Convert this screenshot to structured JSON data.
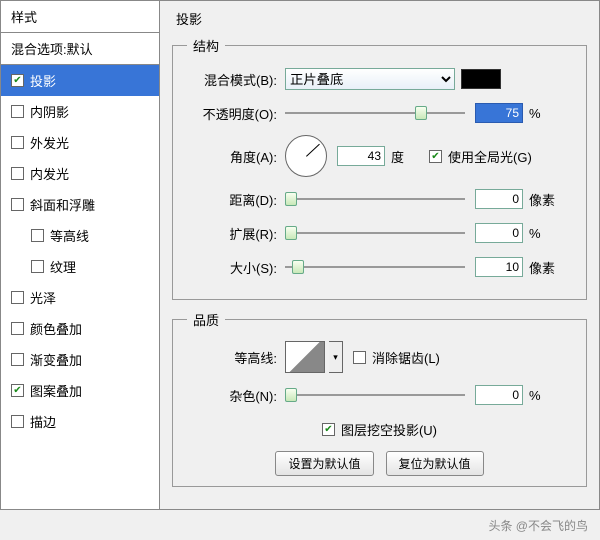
{
  "sidebar": {
    "header": "样式",
    "subheader": "混合选项:默认",
    "items": [
      {
        "label": "投影",
        "checked": true,
        "selected": true
      },
      {
        "label": "内阴影",
        "checked": false
      },
      {
        "label": "外发光",
        "checked": false
      },
      {
        "label": "内发光",
        "checked": false
      },
      {
        "label": "斜面和浮雕",
        "checked": false
      },
      {
        "label": "等高线",
        "checked": false,
        "indent": true
      },
      {
        "label": "纹理",
        "checked": false,
        "indent": true
      },
      {
        "label": "光泽",
        "checked": false
      },
      {
        "label": "颜色叠加",
        "checked": false
      },
      {
        "label": "渐变叠加",
        "checked": false
      },
      {
        "label": "图案叠加",
        "checked": true
      },
      {
        "label": "描边",
        "checked": false
      }
    ]
  },
  "panel": {
    "title": "投影",
    "structure": {
      "legend": "结构",
      "blend_mode_label": "混合模式(B):",
      "blend_mode_value": "正片叠底",
      "color": "#000000",
      "opacity_label": "不透明度(O):",
      "opacity_value": "75",
      "opacity_unit": "%",
      "angle_label": "角度(A):",
      "angle_value": "43",
      "angle_unit": "度",
      "global_light_label": "使用全局光(G)",
      "global_light_checked": true,
      "distance_label": "距离(D):",
      "distance_value": "0",
      "distance_unit": "像素",
      "spread_label": "扩展(R):",
      "spread_value": "0",
      "spread_unit": "%",
      "size_label": "大小(S):",
      "size_value": "10",
      "size_unit": "像素"
    },
    "quality": {
      "legend": "品质",
      "contour_label": "等高线:",
      "antialias_label": "消除锯齿(L)",
      "antialias_checked": false,
      "noise_label": "杂色(N):",
      "noise_value": "0",
      "noise_unit": "%",
      "knockout_label": "图层挖空投影(U)",
      "knockout_checked": true,
      "set_default": "设置为默认值",
      "reset_default": "复位为默认值"
    }
  },
  "footer": "头条 @不会飞的鸟"
}
